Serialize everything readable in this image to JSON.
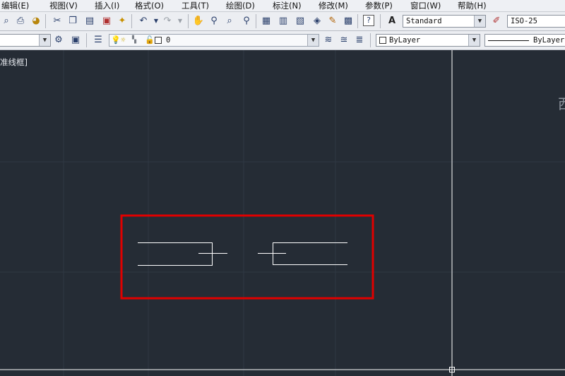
{
  "menubar": {
    "items": [
      "编辑(E)",
      "视图(V)",
      "插入(I)",
      "格式(O)",
      "工具(T)",
      "绘图(D)",
      "标注(N)",
      "修改(M)",
      "参数(P)",
      "窗口(W)",
      "帮助(H)"
    ]
  },
  "toolbar1": {
    "text_style": "Standard",
    "dim_style": "ISO-25"
  },
  "toolbar2": {
    "layer_name": "0",
    "color": "ByLayer",
    "linetype": "ByLayer"
  },
  "viewport": {
    "label": "准线框]"
  },
  "colors": {
    "background": "#252c35",
    "grid": "#2f3843",
    "crosshair": "#ffffff",
    "geometry": "#ffffff",
    "highlight_box": "#e00000"
  },
  "icons": [
    "zoom-icon",
    "print-icon",
    "publish-icon",
    "cut-icon",
    "copy-icon",
    "paste-icon",
    "match-properties-icon",
    "block-editor-icon",
    "undo-icon",
    "redo-icon",
    "pan-icon",
    "zoom-realtime-icon",
    "zoom-window-icon",
    "zoom-previous-icon",
    "properties-icon",
    "design-center-icon",
    "tool-palettes-icon",
    "sheet-set-icon",
    "markup-icon",
    "quickcalc-icon",
    "help-icon",
    "text-style-icon",
    "dim-style-icon",
    "layer-states-icon",
    "layer-on-icon",
    "layer-freeze-icon",
    "layer-lock-icon",
    "layer-color-icon",
    "make-current-icon",
    "layer-previous-icon",
    "layer-isolate-icon"
  ]
}
